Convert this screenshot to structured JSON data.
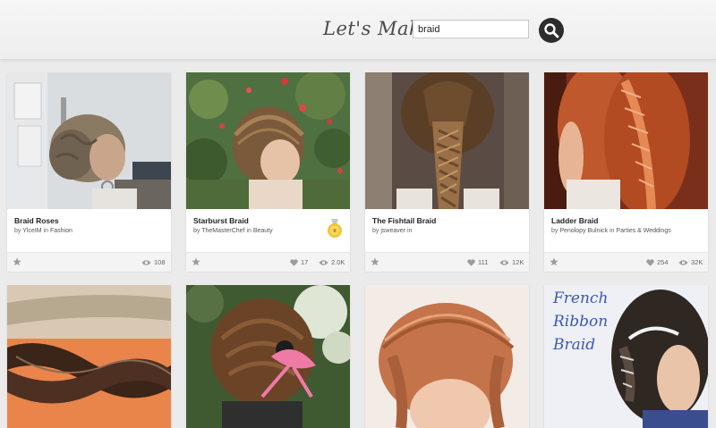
{
  "header": {
    "brand": "Let's Make",
    "search_value": "braid"
  },
  "cards": [
    {
      "title": "Braid Roses",
      "author": "YlceIM",
      "channel": "Fashion",
      "likes": "",
      "views": "108"
    },
    {
      "title": "Starburst Braid",
      "author": "TheMasterChef",
      "channel": "Beauty",
      "likes": "17",
      "views": "2.0K"
    },
    {
      "title": "The Fishtail Braid",
      "author": "jsweaver",
      "channel": "",
      "likes": "111",
      "views": "12K"
    },
    {
      "title": "Ladder Braid",
      "author": "Penolopy Bulnick",
      "channel": "Parties & Weddings",
      "likes": "254",
      "views": "32K"
    }
  ],
  "row2_cards": [
    {
      "image_text": [
        "French",
        "Ribbon",
        "Braid"
      ]
    }
  ],
  "by_word": "by",
  "in_word": "in",
  "colors": {
    "header_bg": "#f1f1f1",
    "search_button": "#2d2d2d",
    "page_bg": "#ebebeb",
    "french_ribbon_text": "#3b58b8"
  }
}
